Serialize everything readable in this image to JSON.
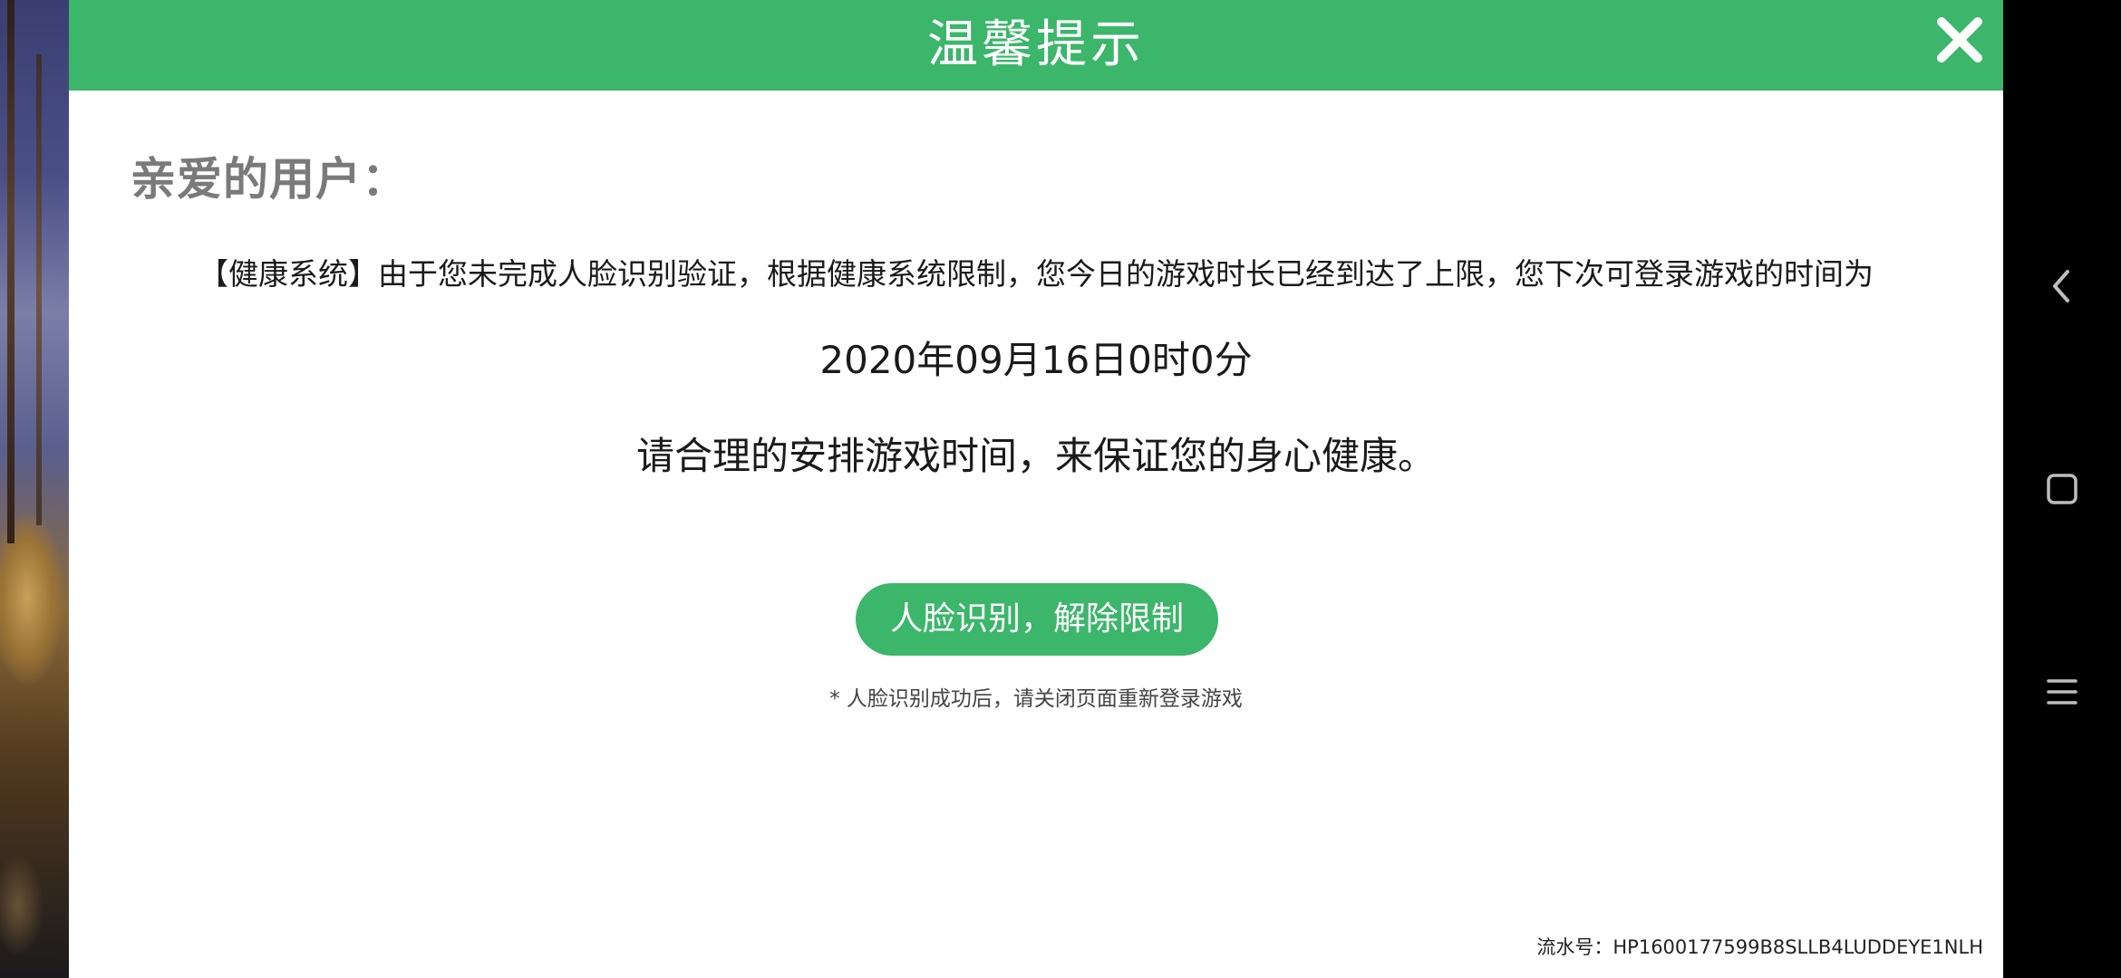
{
  "dialog": {
    "title": "温馨提示",
    "greeting": "亲爱的用户：",
    "message": "【健康系统】由于您未完成人脸识别验证，根据健康系统限制，您今日的游戏时长已经到达了上限，您下次可登录游戏的时间为",
    "next_login_time": "2020年09月16日0时0分",
    "advice": "请合理的安排游戏时间，来保证您的身心健康。",
    "action_button_label": "人脸识别，解除限制",
    "note": "* 人脸识别成功后，请关闭页面重新登录游戏",
    "serial": "流水号：HP1600177599B8SLLB4LUDDEYE1NLH"
  },
  "colors": {
    "accent": "#3bb66a",
    "greeting_text": "#7a7a7a",
    "nav_background": "#000000"
  },
  "icons": {
    "close": "close-icon",
    "back": "back-icon",
    "home": "home-icon",
    "menu": "menu-icon"
  }
}
